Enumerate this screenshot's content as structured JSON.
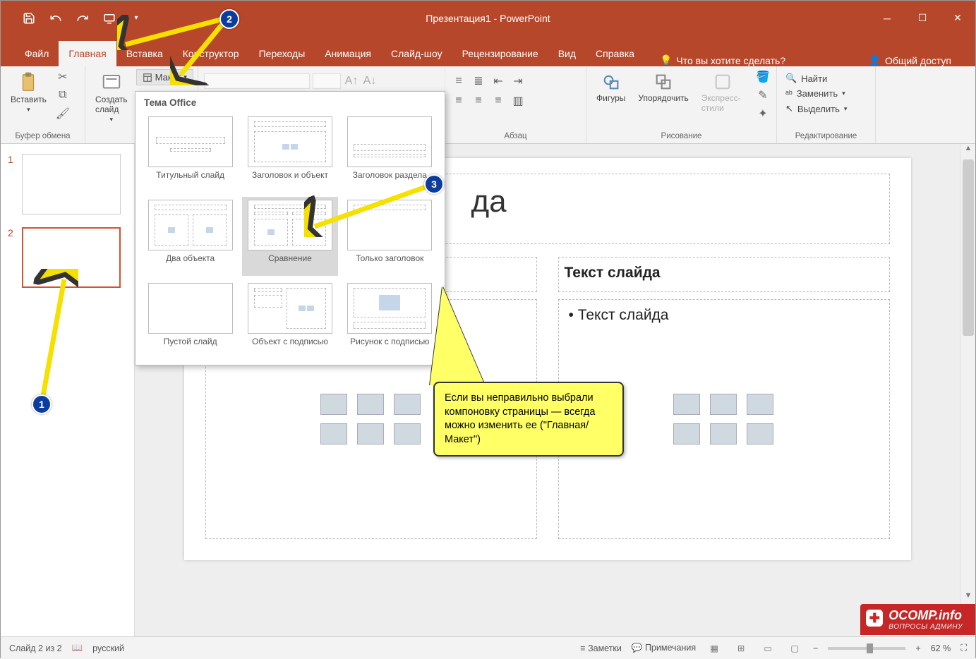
{
  "title": "Презентация1 - PowerPoint",
  "tabs": [
    "Файл",
    "Главная",
    "Вставка",
    "Конструктор",
    "Переходы",
    "Анимация",
    "Слайд-шоу",
    "Рецензирование",
    "Вид",
    "Справка"
  ],
  "active_tab": "Главная",
  "tellme": "Что вы хотите сделать?",
  "share": "Общий доступ",
  "ribbon": {
    "paste": "Вставить",
    "new_slide": "Создать слайд",
    "layout": "Макет",
    "clipboard_group": "Буфер обмена",
    "paragraph_group": "Абзац",
    "shapes": "Фигуры",
    "arrange": "Упорядочить",
    "styles": "Экспресс-стили",
    "drawing_group": "Рисование",
    "find": "Найти",
    "replace": "Заменить",
    "select": "Выделить",
    "editing_group": "Редактирование"
  },
  "dropdown": {
    "title": "Тема Office",
    "items": [
      "Титульный слайд",
      "Заголовок и объект",
      "Заголовок раздела",
      "Два объекта",
      "Сравнение",
      "Только заголовок",
      "Пустой слайд",
      "Объект с подписью",
      "Рисунок с подписью"
    ],
    "selected_index": 4
  },
  "slide": {
    "title_suffix": "да",
    "text_header": "Текст слайда",
    "bullet": "Текст слайда"
  },
  "thumbs": [
    "1",
    "2"
  ],
  "status": {
    "slide_info": "Слайд 2 из 2",
    "lang": "русский",
    "notes": "Заметки",
    "comments": "Примечания",
    "zoom": "62 %"
  },
  "callout": "Если вы неправильно выбрали компоновку страницы — всегда можно изменить ее (\"Главная/Макет\")",
  "badges": [
    "1",
    "2",
    "3"
  ],
  "watermark": {
    "main": "OCOMP.info",
    "sub": "ВОПРОСЫ АДМИНУ"
  }
}
